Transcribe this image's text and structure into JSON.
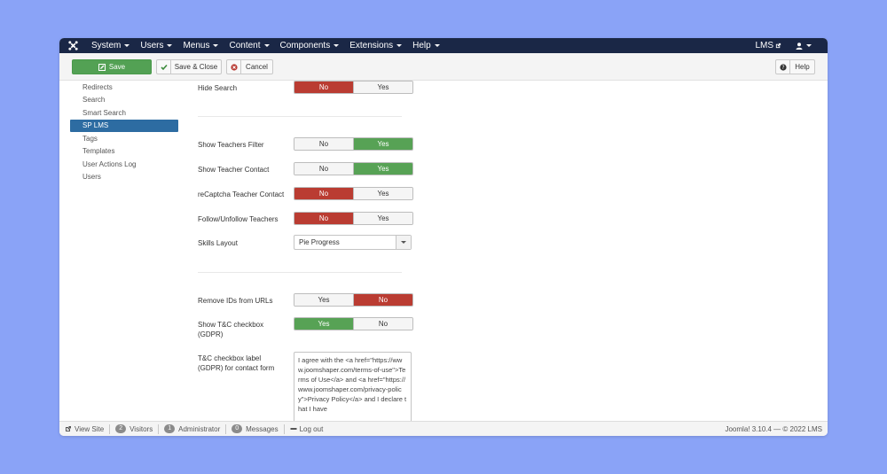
{
  "navbar": {
    "menu": [
      {
        "label": "System"
      },
      {
        "label": "Users"
      },
      {
        "label": "Menus"
      },
      {
        "label": "Content"
      },
      {
        "label": "Components"
      },
      {
        "label": "Extensions"
      },
      {
        "label": "Help"
      }
    ],
    "site_name": "LMS"
  },
  "toolbar": {
    "save": "Save",
    "save_close": "Save & Close",
    "cancel": "Cancel",
    "help": "Help"
  },
  "sidebar": {
    "items": [
      {
        "label": "Redirects"
      },
      {
        "label": "Search"
      },
      {
        "label": "Smart Search"
      },
      {
        "label": "SP LMS",
        "active": true
      },
      {
        "label": "Tags"
      },
      {
        "label": "Templates"
      },
      {
        "label": "User Actions Log"
      },
      {
        "label": "Users"
      }
    ]
  },
  "fields": {
    "hide_search": {
      "label": "Hide Search",
      "opt1": "No",
      "opt2": "Yes",
      "selected": "No"
    },
    "show_teachers_filter": {
      "label": "Show Teachers Filter",
      "opt1": "No",
      "opt2": "Yes",
      "selected": "Yes"
    },
    "show_teacher_contact": {
      "label": "Show Teacher Contact",
      "opt1": "No",
      "opt2": "Yes",
      "selected": "Yes"
    },
    "recaptcha_teacher_contact": {
      "label": "reCaptcha Teacher Contact",
      "opt1": "No",
      "opt2": "Yes",
      "selected": "No"
    },
    "follow_unfollow_teachers": {
      "label": "Follow/Unfollow Teachers",
      "opt1": "No",
      "opt2": "Yes",
      "selected": "No"
    },
    "skills_layout": {
      "label": "Skills Layout",
      "value": "Pie Progress"
    },
    "remove_ids": {
      "label": "Remove IDs from URLs",
      "opt1": "Yes",
      "opt2": "No",
      "selected": "No"
    },
    "show_tc_checkbox": {
      "label": "Show T&C checkbox (GDPR)",
      "opt1": "Yes",
      "opt2": "No",
      "selected": "Yes"
    },
    "tc_checkbox_label": {
      "label": "T&C checkbox label (GDPR) for contact form",
      "value": "I agree with the <a href=\"https://www.joomshaper.com/terms-of-use\">Terms of Use</a> and <a href=\"https://www.joomshaper.com/privacy-policy\">Privacy Policy</a> and I declare that I have"
    }
  },
  "statusbar": {
    "view_site": "View Site",
    "visitors_count": "2",
    "visitors": "Visitors",
    "admin_count": "1",
    "admin": "Administrator",
    "messages_count": "0",
    "messages": "Messages",
    "logout": "Log out",
    "version": "Joomla! 3.10.4 — © 2022 LMS"
  },
  "colors": {
    "navbar": "#1a2746",
    "save_green": "#53a154",
    "toggle_red": "#ba3c32",
    "toggle_green": "#57a255",
    "active_blue": "#2d6ca2"
  }
}
